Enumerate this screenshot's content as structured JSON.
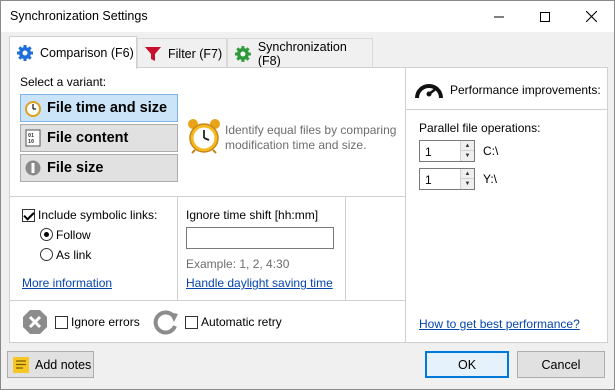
{
  "window": {
    "title": "Synchronization Settings"
  },
  "tabs": [
    {
      "label": "Comparison (F6)",
      "icon": "gear-icon",
      "active": true
    },
    {
      "label": "Filter (F7)",
      "icon": "filter-icon",
      "active": false
    },
    {
      "label": "Synchronization (F8)",
      "icon": "gear-icon",
      "active": false
    }
  ],
  "comparison": {
    "select_variant_label": "Select a variant:",
    "variants": [
      {
        "label": "File time and size",
        "icon": "clock-icon",
        "selected": true
      },
      {
        "label": "File content",
        "icon": "binary-file-icon",
        "selected": false
      },
      {
        "label": "File size",
        "icon": "size-icon",
        "selected": false
      }
    ],
    "description": "Identify equal files by comparing modification time and size.",
    "description_lines": [
      "Identify equal files by comparing",
      "modification time and size."
    ],
    "symlinks": {
      "label": "Include symbolic links:",
      "checked": true,
      "options": [
        {
          "label": "Follow",
          "selected": true
        },
        {
          "label": "As link",
          "selected": false
        }
      ]
    },
    "more_info_link": "More information",
    "time_shift": {
      "label": "Ignore time shift [hh:mm]",
      "value": "",
      "example": "Example:  1, 2, 4:30",
      "dst_link": "Handle daylight saving time"
    },
    "ignore_errors": {
      "label": "Ignore errors",
      "checked": false
    },
    "auto_retry": {
      "label": "Automatic retry",
      "checked": false
    }
  },
  "performance": {
    "title": "Performance improvements:",
    "parallel_label": "Parallel file operations:",
    "drives": [
      {
        "value": "1",
        "label": "C:\\"
      },
      {
        "value": "1",
        "label": "Y:\\"
      }
    ],
    "best_perf_link": "How to get best performance?"
  },
  "footer": {
    "add_notes": "Add notes",
    "ok": "OK",
    "cancel": "Cancel"
  },
  "colors": {
    "accent": "#0078d7",
    "link": "#0645ad",
    "selected_variant_bg": "#cce4f7"
  }
}
